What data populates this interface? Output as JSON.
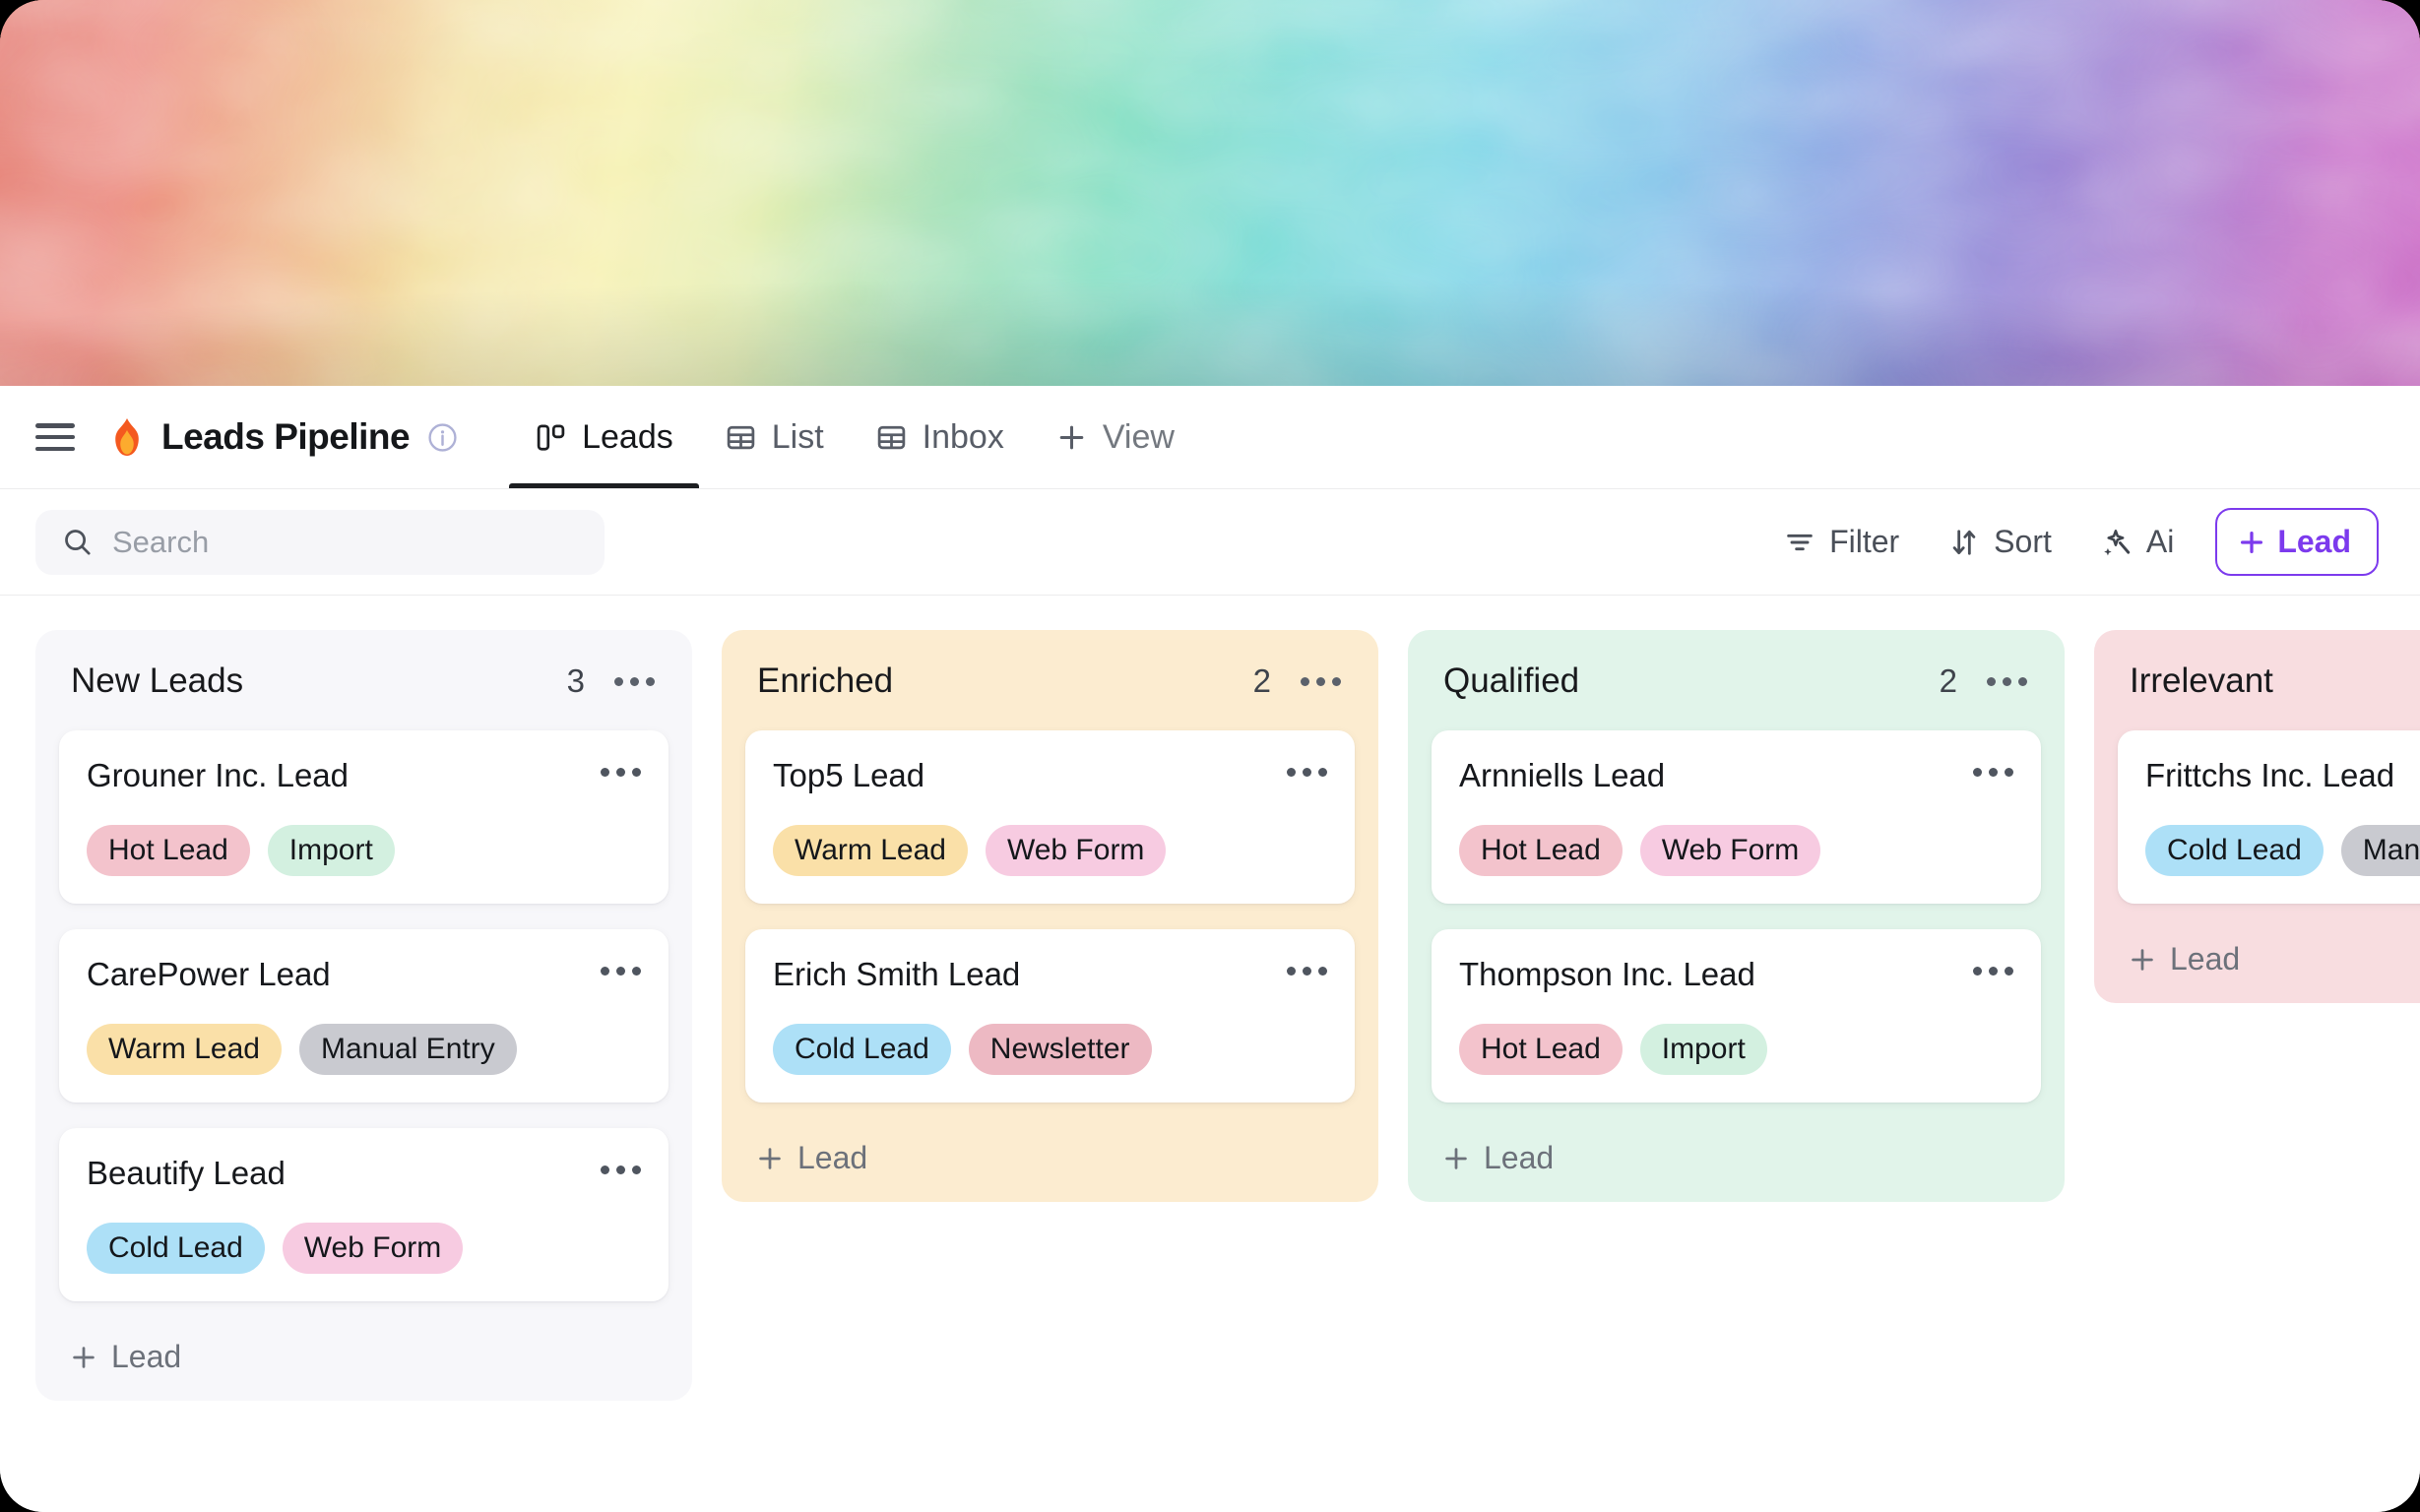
{
  "window": {
    "hero_alt": "rainbow-ink-smoke-cover"
  },
  "header": {
    "menu_icon": "hamburger-icon",
    "logo_icon": "flame-emoji",
    "title": "Leads Pipeline",
    "info_icon": "info-circle-icon",
    "tabs": [
      {
        "label": "Leads",
        "icon": "kanban-board-icon",
        "active": true
      },
      {
        "label": "List",
        "icon": "table-grid-icon",
        "active": false
      },
      {
        "label": "Inbox",
        "icon": "table-grid-icon",
        "active": false
      },
      {
        "label": "View",
        "icon": "plus-icon",
        "active": false
      }
    ]
  },
  "toolbar": {
    "search": {
      "icon": "search-icon",
      "value": "",
      "placeholder": "Search"
    },
    "filter_label": "Filter",
    "filter_icon": "filter-lines-icon",
    "sort_label": "Sort",
    "sort_icon": "sort-arrows-icon",
    "ai_label": "Ai",
    "ai_icon": "magic-wand-sparkle-icon",
    "add_lead_label": "Lead",
    "add_lead_icon": "plus-icon",
    "accent_color": "#7c3aed"
  },
  "board": {
    "add_lead_label": "Lead",
    "columns": [
      {
        "title": "New Leads",
        "count": "3",
        "bg": "#f7f7fa",
        "cards": [
          {
            "title": "Grouner Inc. Lead",
            "tags": [
              {
                "label": "Hot Lead",
                "bg": "#f3c3cc"
              },
              {
                "label": "Import",
                "bg": "#d3f0e0"
              }
            ]
          },
          {
            "title": "CarePower Lead",
            "tags": [
              {
                "label": "Warm Lead",
                "bg": "#fae0a8"
              },
              {
                "label": "Manual Entry",
                "bg": "#c9cad0"
              }
            ]
          },
          {
            "title": "Beautify Lead",
            "tags": [
              {
                "label": "Cold Lead",
                "bg": "#ade0f7"
              },
              {
                "label": "Web Form",
                "bg": "#f7cbe1"
              }
            ]
          }
        ]
      },
      {
        "title": "Enriched",
        "count": "2",
        "bg": "#fcecd0",
        "cards": [
          {
            "title": "Top5 Lead",
            "tags": [
              {
                "label": "Warm Lead",
                "bg": "#fae0a8"
              },
              {
                "label": "Web Form",
                "bg": "#f7cbe1"
              }
            ]
          },
          {
            "title": "Erich Smith Lead",
            "tags": [
              {
                "label": "Cold Lead",
                "bg": "#ade0f7"
              },
              {
                "label": "Newsletter",
                "bg": "#edb9c3"
              }
            ]
          }
        ]
      },
      {
        "title": "Qualified",
        "count": "2",
        "bg": "#e1f4ea",
        "cards": [
          {
            "title": "Arnniells Lead",
            "tags": [
              {
                "label": "Hot Lead",
                "bg": "#f3c3cc"
              },
              {
                "label": "Web Form",
                "bg": "#f7cbe1"
              }
            ]
          },
          {
            "title": "Thompson Inc. Lead",
            "tags": [
              {
                "label": "Hot Lead",
                "bg": "#f3c3cc"
              },
              {
                "label": "Import",
                "bg": "#d3f0e0"
              }
            ]
          }
        ]
      },
      {
        "title": "Irrelevant",
        "count": "",
        "bg": "#f8dde0",
        "cards": [
          {
            "title": "Frittchs Inc. Lead",
            "tags": [
              {
                "label": "Cold Lead",
                "bg": "#ade0f7"
              },
              {
                "label": "Manual Entry",
                "bg": "#c9cad0"
              }
            ]
          }
        ]
      }
    ]
  }
}
